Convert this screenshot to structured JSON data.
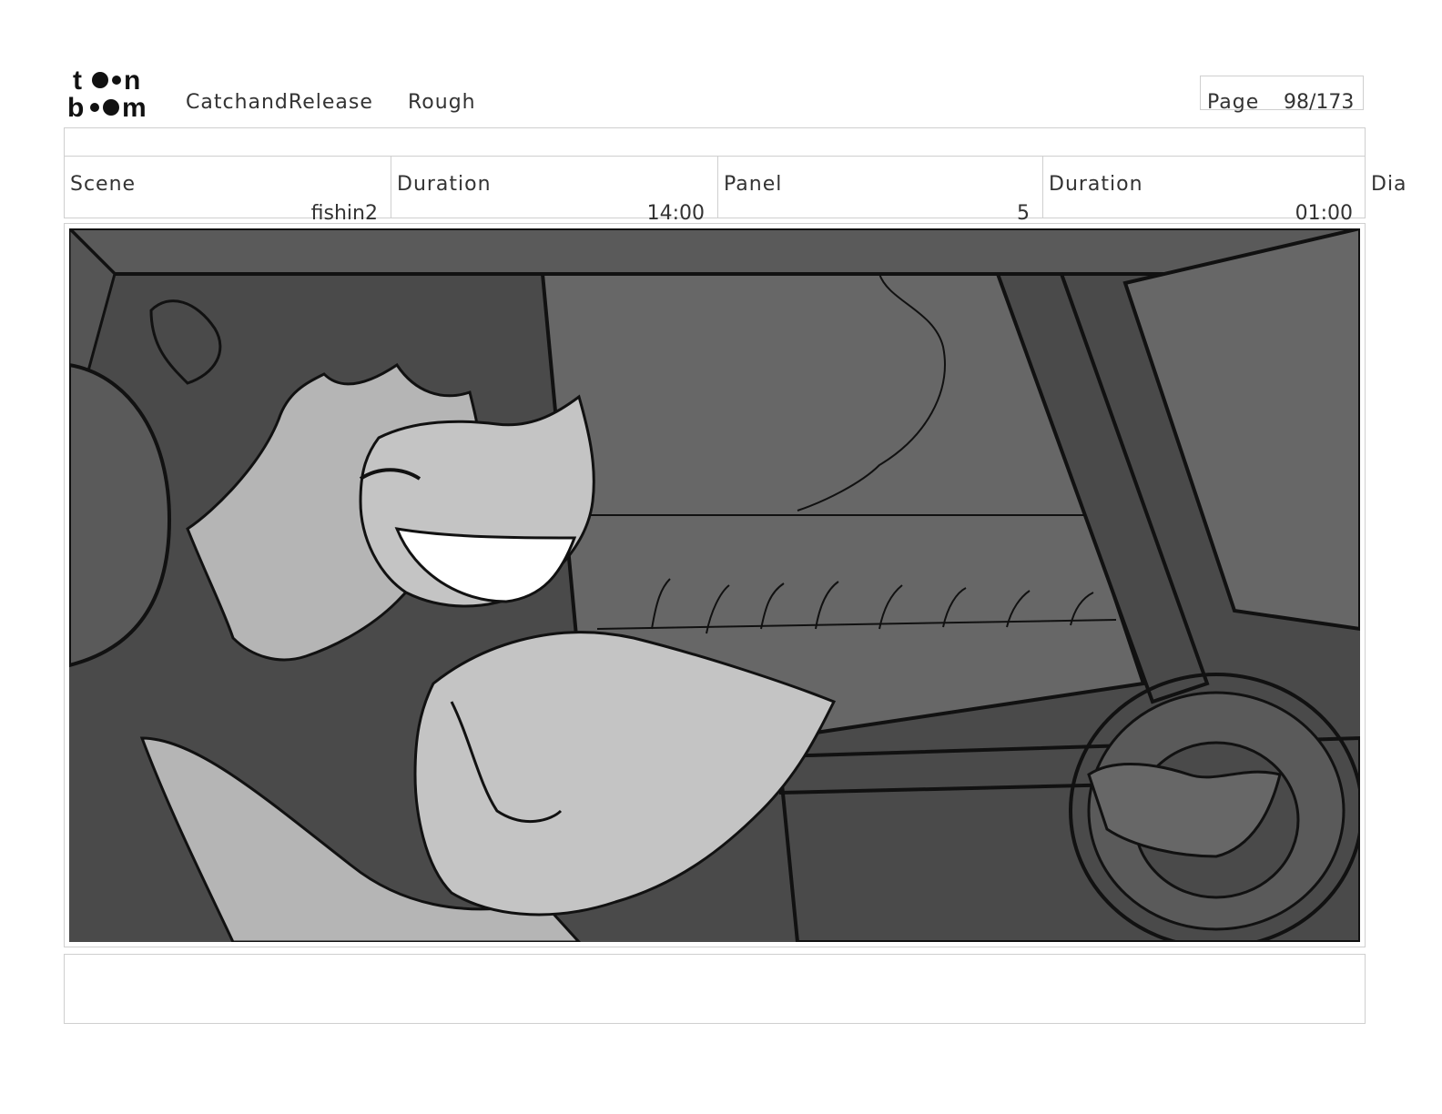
{
  "header": {
    "logo_text": "toonboom",
    "project": "CatchandRelease",
    "stage": "Rough",
    "page_label": "Page",
    "page_value": "98/173"
  },
  "info": {
    "scene_label": "Scene",
    "scene_value": "fishin2",
    "scene_duration_label": "Duration",
    "scene_duration_value": "14:00",
    "panel_label": "Panel",
    "panel_value": "5",
    "panel_duration_label": "Duration",
    "panel_duration_value": "01:00",
    "dialogue_label": "Dia"
  },
  "frame": {
    "icon": "storyboard-drawing",
    "palette": {
      "dark": "#4a4a4a",
      "mid": "#676767",
      "light": "#b5b5b5",
      "lighter": "#c4c4c4",
      "line": "#111111"
    }
  }
}
